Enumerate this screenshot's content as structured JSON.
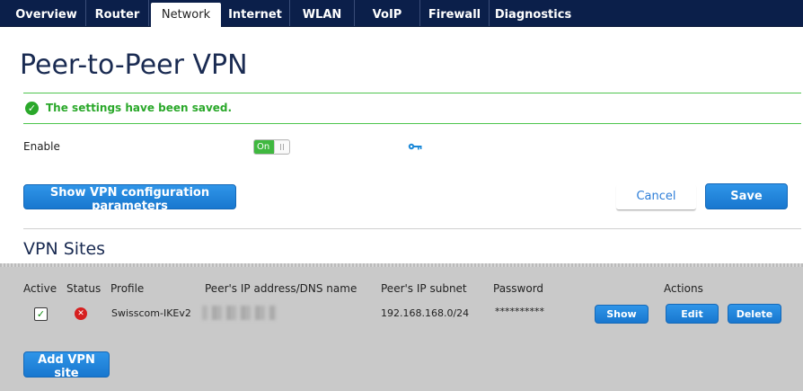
{
  "nav": {
    "tabs": [
      {
        "label": "Overview"
      },
      {
        "label": "Router"
      },
      {
        "label": "Network",
        "active": true
      },
      {
        "label": "Internet"
      },
      {
        "label": "WLAN"
      },
      {
        "label": "VoIP"
      },
      {
        "label": "Firewall"
      },
      {
        "label": "Diagnostics"
      }
    ]
  },
  "page": {
    "title": "Peer-to-Peer VPN",
    "saved_message": "The settings have been saved."
  },
  "enable": {
    "label": "Enable",
    "toggle_label": "On",
    "state": true
  },
  "buttons": {
    "show_params": "Show VPN configuration parameters",
    "cancel": "Cancel",
    "save": "Save",
    "add_site": "Add VPN site"
  },
  "sites": {
    "title": "VPN Sites",
    "columns": {
      "active": "Active",
      "status": "Status",
      "profile": "Profile",
      "peer_ip": "Peer's IP address/DNS name",
      "peer_subnet": "Peer's IP subnet",
      "password": "Password",
      "actions": "Actions"
    },
    "rows": [
      {
        "active": true,
        "status": "error",
        "profile": "Swisscom-IKEv2",
        "peer_subnet": "192.168.168.0/24",
        "password": "**********",
        "show_label": "Show",
        "edit_label": "Edit",
        "delete_label": "Delete"
      }
    ]
  },
  "colors": {
    "nav_bg": "#0b1f4a",
    "success": "#2aa82a",
    "accent": "#1e82da",
    "error": "#d62020",
    "panel_bg": "#c9c9c9"
  },
  "icons": {
    "saved": "check-circle-icon",
    "enable_info": "key-icon",
    "active": "checkbox-checked-icon",
    "status": "error-x-icon"
  }
}
